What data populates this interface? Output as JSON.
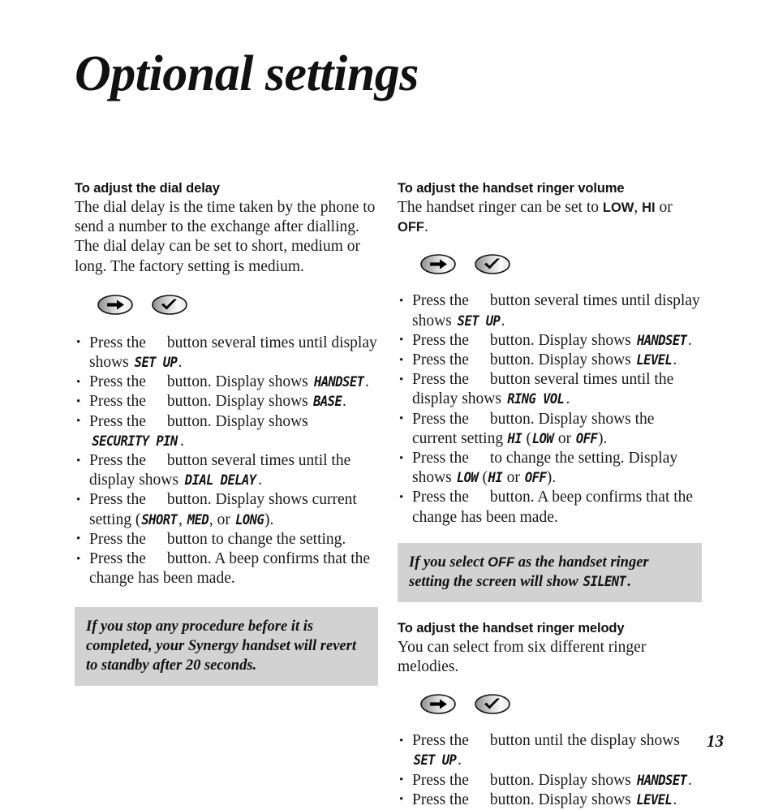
{
  "page": {
    "title": "Optional settings",
    "number": "13"
  },
  "icons": {
    "scroll": "right-arrow-key-icon",
    "confirm": "check-mark-key-icon"
  },
  "left_column": {
    "section": {
      "heading": "To adjust the dial delay",
      "intro": "The dial delay is the time taken by the phone to send a number to the exchange after dialling. The dial delay can be set to short, medium or long. The factory setting is medium.",
      "steps": [
        {
          "pre": "Press the",
          "post": "button several times until display shows",
          "lcd": "SET UP",
          "tail": "."
        },
        {
          "pre": "Press the",
          "post": "button. Display shows",
          "lcd": "HANDSET",
          "tail": "."
        },
        {
          "pre": "Press the",
          "post": "button. Display shows",
          "lcd": "BASE",
          "tail": "."
        },
        {
          "pre": "Press the",
          "post": "button. Display shows",
          "lcd": "SECURITY PIN",
          "tail": "."
        },
        {
          "pre": "Press the",
          "post": "button several times until the display shows",
          "lcd": "DIAL DELAY",
          "tail": "."
        },
        {
          "pre": "Press the",
          "post": "button. Display shows current setting (",
          "lcd": "SHORT",
          "mid1": ", ",
          "lcd2": "MED",
          "mid2": ", or ",
          "lcd3": "LONG",
          "tail": ")."
        },
        {
          "pre": "Press the",
          "post": "button to change the setting.",
          "lcd": "",
          "tail": ""
        },
        {
          "pre": "Press the",
          "post": "button. A beep confirms that the change has been made.",
          "lcd": "",
          "tail": ""
        }
      ]
    },
    "note": {
      "text": "If you stop any procedure before it is completed, your Synergy handset will revert to standby after 20 seconds."
    }
  },
  "right_column": {
    "volume_section": {
      "heading": "To adjust the handset ringer volume",
      "intro_pre": "The handset ringer can be set to ",
      "intro_b1": "LOW",
      "intro_mid1": ", ",
      "intro_b2": "HI",
      "intro_mid2": " or ",
      "intro_b3": "OFF",
      "intro_tail": ".",
      "steps": [
        {
          "pre": "Press the",
          "post": "button several times until display shows",
          "lcd": "SET UP",
          "tail": "."
        },
        {
          "pre": "Press the",
          "post": "button. Display shows",
          "lcd": "HANDSET",
          "tail": "."
        },
        {
          "pre": "Press the",
          "post": "button. Display shows",
          "lcd": "LEVEL",
          "tail": "."
        },
        {
          "pre": "Press the",
          "post": "button several times until the display shows",
          "lcd": "RING VOL",
          "tail": "."
        },
        {
          "pre": "Press the",
          "post": "button. Display shows the current setting",
          "lcd": "HI",
          "mid1": " (",
          "lcd2": "LOW",
          "mid2": " or ",
          "lcd3": "OFF",
          "tail": ")."
        },
        {
          "pre": "Press the",
          "post": "to change the setting. Display shows",
          "lcd": "LOW",
          "mid1": " (",
          "lcd2": "HI",
          "mid2": " or ",
          "lcd3": "OFF",
          "tail": ")."
        },
        {
          "pre": "Press the",
          "post": "button. A beep confirms that the change has been made.",
          "lcd": "",
          "tail": ""
        }
      ]
    },
    "note": {
      "pre": "If you select ",
      "bold": "OFF",
      "mid": " as the handset ringer setting the screen will show ",
      "lcd": "SILENT",
      "tail": "."
    },
    "melody_section": {
      "heading": "To adjust the handset ringer melody",
      "intro": "You can select from six different ringer melodies.",
      "steps": [
        {
          "pre": "Press the",
          "post": "button until the display shows",
          "lcd": "SET UP",
          "tail": "."
        },
        {
          "pre": "Press the",
          "post": "button. Display shows",
          "lcd": "HANDSET",
          "tail": "."
        },
        {
          "pre": "Press the",
          "post": "button. Display shows",
          "lcd": "LEVEL",
          "tail": "."
        }
      ]
    }
  }
}
